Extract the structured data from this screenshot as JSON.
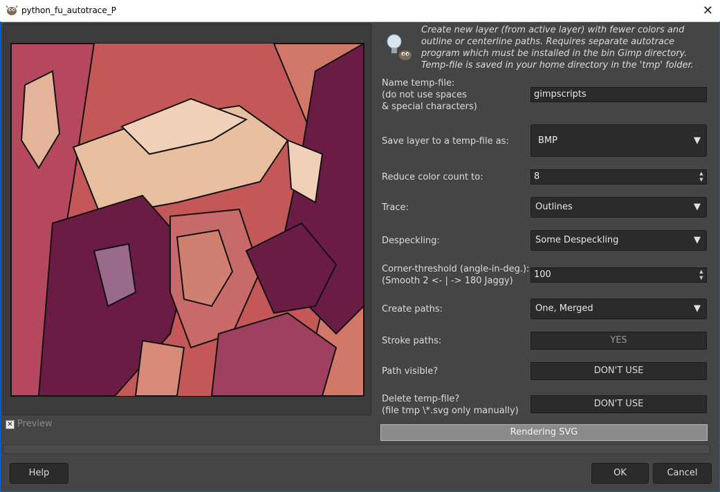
{
  "window": {
    "title": "python_fu_autotrace_P"
  },
  "preview": {
    "label": "Preview",
    "checked": true
  },
  "description": "Create new layer (from active layer) with fewer colors and outline or centerline paths. Requires separate autotrace program which must be installed in the bin Gimp directory. Temp-file is saved in your home directory in the 'tmp' folder.",
  "fields": {
    "temp_name": {
      "label_lines": [
        "Name temp-file:",
        "(do not use spaces",
        "& special characters)"
      ],
      "value": "gimpscripts"
    },
    "save_as": {
      "label": "Save layer to a temp-file as:",
      "value": "BMP"
    },
    "color_count": {
      "label": "Reduce color count to:",
      "value": "8"
    },
    "trace": {
      "label": "Trace:",
      "value": "Outlines"
    },
    "despeckling": {
      "label": "Despeckling:",
      "value": "Some Despeckling"
    },
    "corner": {
      "label_lines": [
        "Corner-threshold (angle-in-deg.):",
        "(Smooth 2 <- | -> 180 Jaggy)"
      ],
      "value": "100"
    },
    "create_paths": {
      "label": "Create paths:",
      "value": "One, Merged"
    },
    "stroke_paths": {
      "label": "Stroke paths:",
      "value": "YES"
    },
    "path_visible": {
      "label": "Path visible?",
      "value": "DON'T USE"
    },
    "delete_temp": {
      "label_lines": [
        "Delete temp-file?",
        "(file tmp \\*.svg only manually)"
      ],
      "value": "DON'T USE"
    }
  },
  "progress": {
    "text": "Rendering SVG"
  },
  "buttons": {
    "help": "Help",
    "ok": "OK",
    "cancel": "Cancel"
  },
  "icons": {
    "close": "close-icon",
    "chevron": "chevron-down-icon",
    "app": "gimp-icon",
    "bulb": "lightbulb-icon"
  }
}
